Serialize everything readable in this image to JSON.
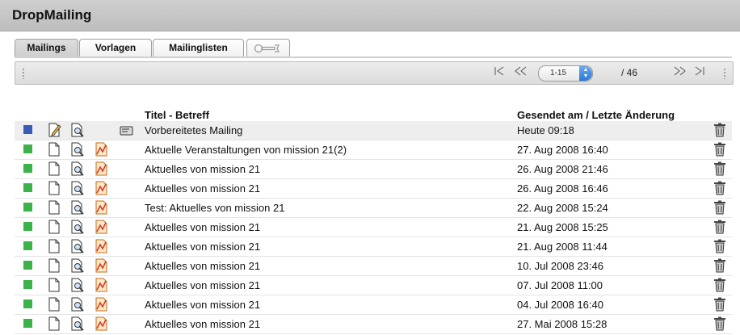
{
  "app": {
    "title": "DropMailing"
  },
  "tabs": [
    {
      "label": "Mailings",
      "active": true
    },
    {
      "label": "Vorlagen",
      "active": false
    },
    {
      "label": "Mailinglisten",
      "active": false
    },
    {
      "label": "",
      "icon": "wrench-icon",
      "active": false
    }
  ],
  "toolbar": {
    "first_icon": "first-page-icon",
    "prev_icon": "previous-page-icon",
    "next_icon": "next-page-icon",
    "last_icon": "last-page-icon",
    "page_range": "1-15",
    "page_total": "/ 46"
  },
  "table": {
    "columns": {
      "title": "Titel - Betreff",
      "date": "Gesendet am / Letzte Änderung"
    },
    "rows": [
      {
        "status": "draft",
        "status_color": "#3a5bb7",
        "title": "Vorbereitetes Mailing",
        "date": "Heute 09:18",
        "icons": [
          "edit-icon",
          "preview-icon",
          "send-icon"
        ]
      },
      {
        "status": "sent",
        "status_color": "#3bb34a",
        "title": "Aktuelle Veranstaltungen von mission 21(2)",
        "date": "27. Aug 2008 16:40",
        "icons": [
          "document-icon",
          "preview-icon",
          "statistics-icon"
        ]
      },
      {
        "status": "sent",
        "status_color": "#3bb34a",
        "title": "Aktuelles von mission 21",
        "date": "26. Aug 2008 21:46",
        "icons": [
          "document-icon",
          "preview-icon",
          "statistics-icon"
        ]
      },
      {
        "status": "sent",
        "status_color": "#3bb34a",
        "title": "Aktuelles von mission 21",
        "date": "26. Aug 2008 16:46",
        "icons": [
          "document-icon",
          "preview-icon",
          "statistics-icon"
        ]
      },
      {
        "status": "sent",
        "status_color": "#3bb34a",
        "title": "Test: Aktuelles von mission 21",
        "date": "22. Aug 2008 15:24",
        "icons": [
          "document-icon",
          "preview-icon",
          "statistics-icon"
        ]
      },
      {
        "status": "sent",
        "status_color": "#3bb34a",
        "title": "Aktuelles von mission 21",
        "date": "21. Aug 2008 15:25",
        "icons": [
          "document-icon",
          "preview-icon",
          "statistics-icon"
        ]
      },
      {
        "status": "sent",
        "status_color": "#3bb34a",
        "title": "Aktuelles von mission 21",
        "date": "21. Aug 2008 11:44",
        "icons": [
          "document-icon",
          "preview-icon",
          "statistics-icon"
        ]
      },
      {
        "status": "sent",
        "status_color": "#3bb34a",
        "title": "Aktuelles von mission 21",
        "date": "10. Jul 2008 23:46",
        "icons": [
          "document-icon",
          "preview-icon",
          "statistics-icon"
        ]
      },
      {
        "status": "sent",
        "status_color": "#3bb34a",
        "title": "Aktuelles von mission 21",
        "date": "07. Jul 2008 11:00",
        "icons": [
          "document-icon",
          "preview-icon",
          "statistics-icon"
        ]
      },
      {
        "status": "sent",
        "status_color": "#3bb34a",
        "title": "Aktuelles von mission 21",
        "date": "04. Jul 2008 16:40",
        "icons": [
          "document-icon",
          "preview-icon",
          "statistics-icon"
        ]
      },
      {
        "status": "sent",
        "status_color": "#3bb34a",
        "title": "Aktuelles von mission 21",
        "date": "27. Mai 2008 15:28",
        "icons": [
          "document-icon",
          "preview-icon",
          "statistics-icon"
        ]
      }
    ]
  },
  "colors": {
    "titlebar": "#c4c4c4",
    "draft_row": "#eeeeee",
    "status_sent": "#3bb34a",
    "status_draft": "#3a5bb7"
  }
}
